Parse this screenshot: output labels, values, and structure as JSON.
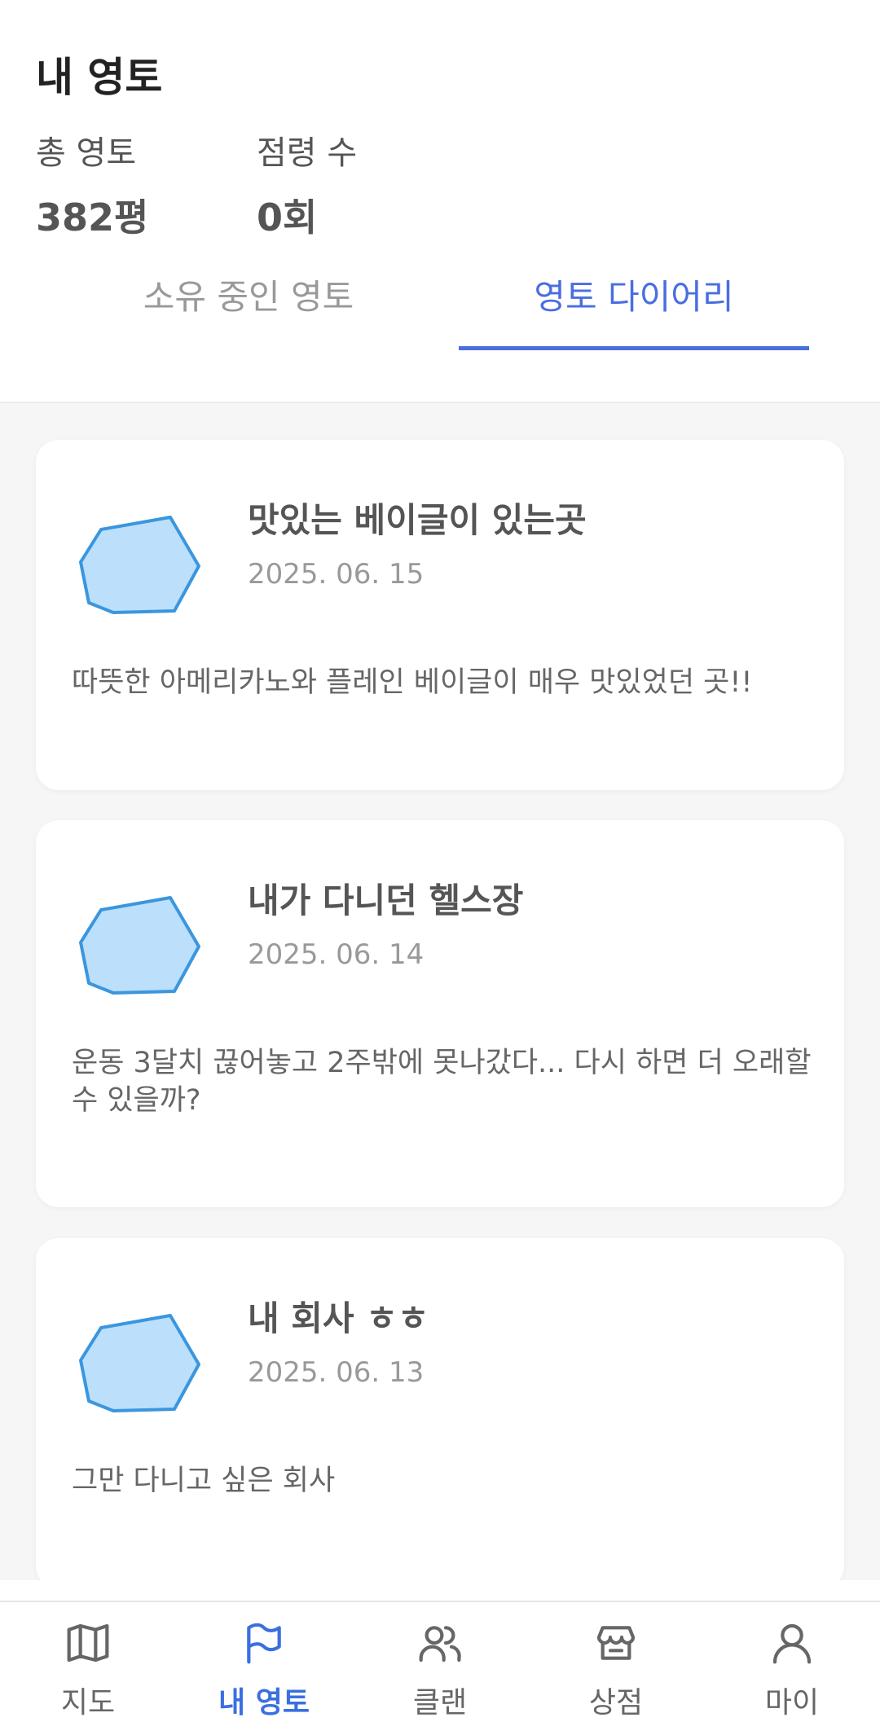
{
  "header": {
    "title": "내 영토",
    "stats": [
      {
        "label": "총 영토",
        "value": "382평"
      },
      {
        "label": "점령 수",
        "value": "0회"
      }
    ]
  },
  "tabs": [
    {
      "label": "소유 중인 영토",
      "active": false
    },
    {
      "label": "영토 다이어리",
      "active": true
    }
  ],
  "diary": [
    {
      "title": "맛있는 베이글이 있는곳",
      "date": "2025. 06. 15",
      "body": "따뜻한 아메리카노와 플레인 베이글이 매우 맛있었던 곳!!"
    },
    {
      "title": "내가 다니던 헬스장",
      "date": "2025. 06. 14",
      "body": "운동 3달치 끊어놓고 2주밖에 못나갔다... 다시 하면 더 오래할 수 있을까?"
    },
    {
      "title": "내 회사 ㅎㅎ",
      "date": "2025. 06. 13",
      "body": "그만 다니고 싶은 회사"
    }
  ],
  "nav": [
    {
      "label": "지도",
      "icon": "map-icon"
    },
    {
      "label": "내 영토",
      "icon": "flag-icon",
      "active": true
    },
    {
      "label": "클랜",
      "icon": "users-icon"
    },
    {
      "label": "상점",
      "icon": "store-icon"
    },
    {
      "label": "마이",
      "icon": "user-icon"
    }
  ],
  "colors": {
    "accent": "#4a6ee0",
    "polygon_fill": "#bcdffb",
    "polygon_stroke": "#3a96de"
  }
}
